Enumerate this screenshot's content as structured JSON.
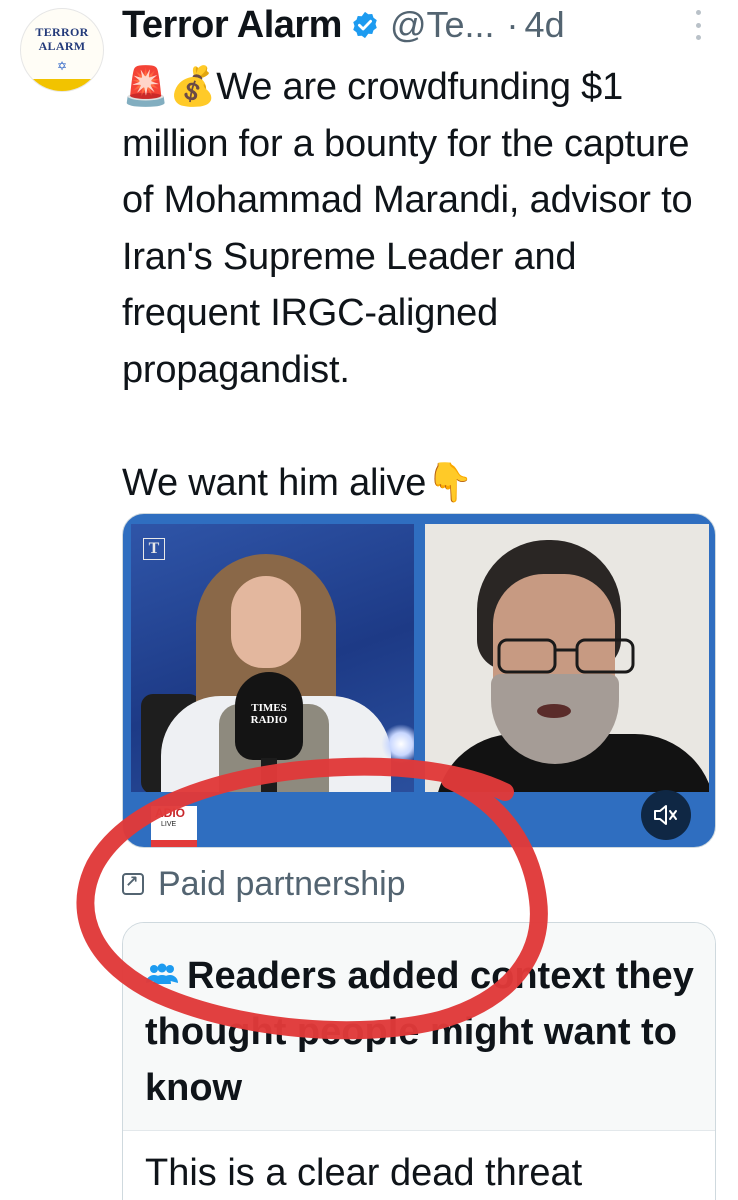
{
  "tweet": {
    "author": {
      "name": "Terror Alarm",
      "handle": "@Te...",
      "separator": "·",
      "age": "4d",
      "avatar_logo_text": "TERROR ALARM",
      "verified_icon": "verified-badge-icon"
    },
    "text": {
      "line1_emojis": "🚨💰",
      "paragraph1": "We are crowdfunding $1 million for a bounty for the capture of Mohammad Marandi, advisor to Iran's Supreme Leader and frequent IRGC-aligned propagandist.",
      "paragraph2": "We want him alive",
      "paragraph2_emoji": "👇"
    },
    "media": {
      "left_panel_logo": "T",
      "mic_label": "TIMES RADIO",
      "badge_top": "ADIO",
      "badge_bottom": "LIVE",
      "mute_icon": "volume-muted-icon"
    },
    "paid_partnership": {
      "label": "Paid partnership",
      "icon": "external-arrow-icon"
    },
    "community_note": {
      "icon": "people-icon",
      "title": "Readers added context they thought people might want to know",
      "body": "This is a clear dead threat"
    }
  },
  "colors": {
    "text_primary": "#0f1419",
    "text_secondary": "#536471",
    "verified_blue": "#1d9bf0",
    "media_frame": "#2f6ec0",
    "annotation_circle": "#e03a3a"
  }
}
